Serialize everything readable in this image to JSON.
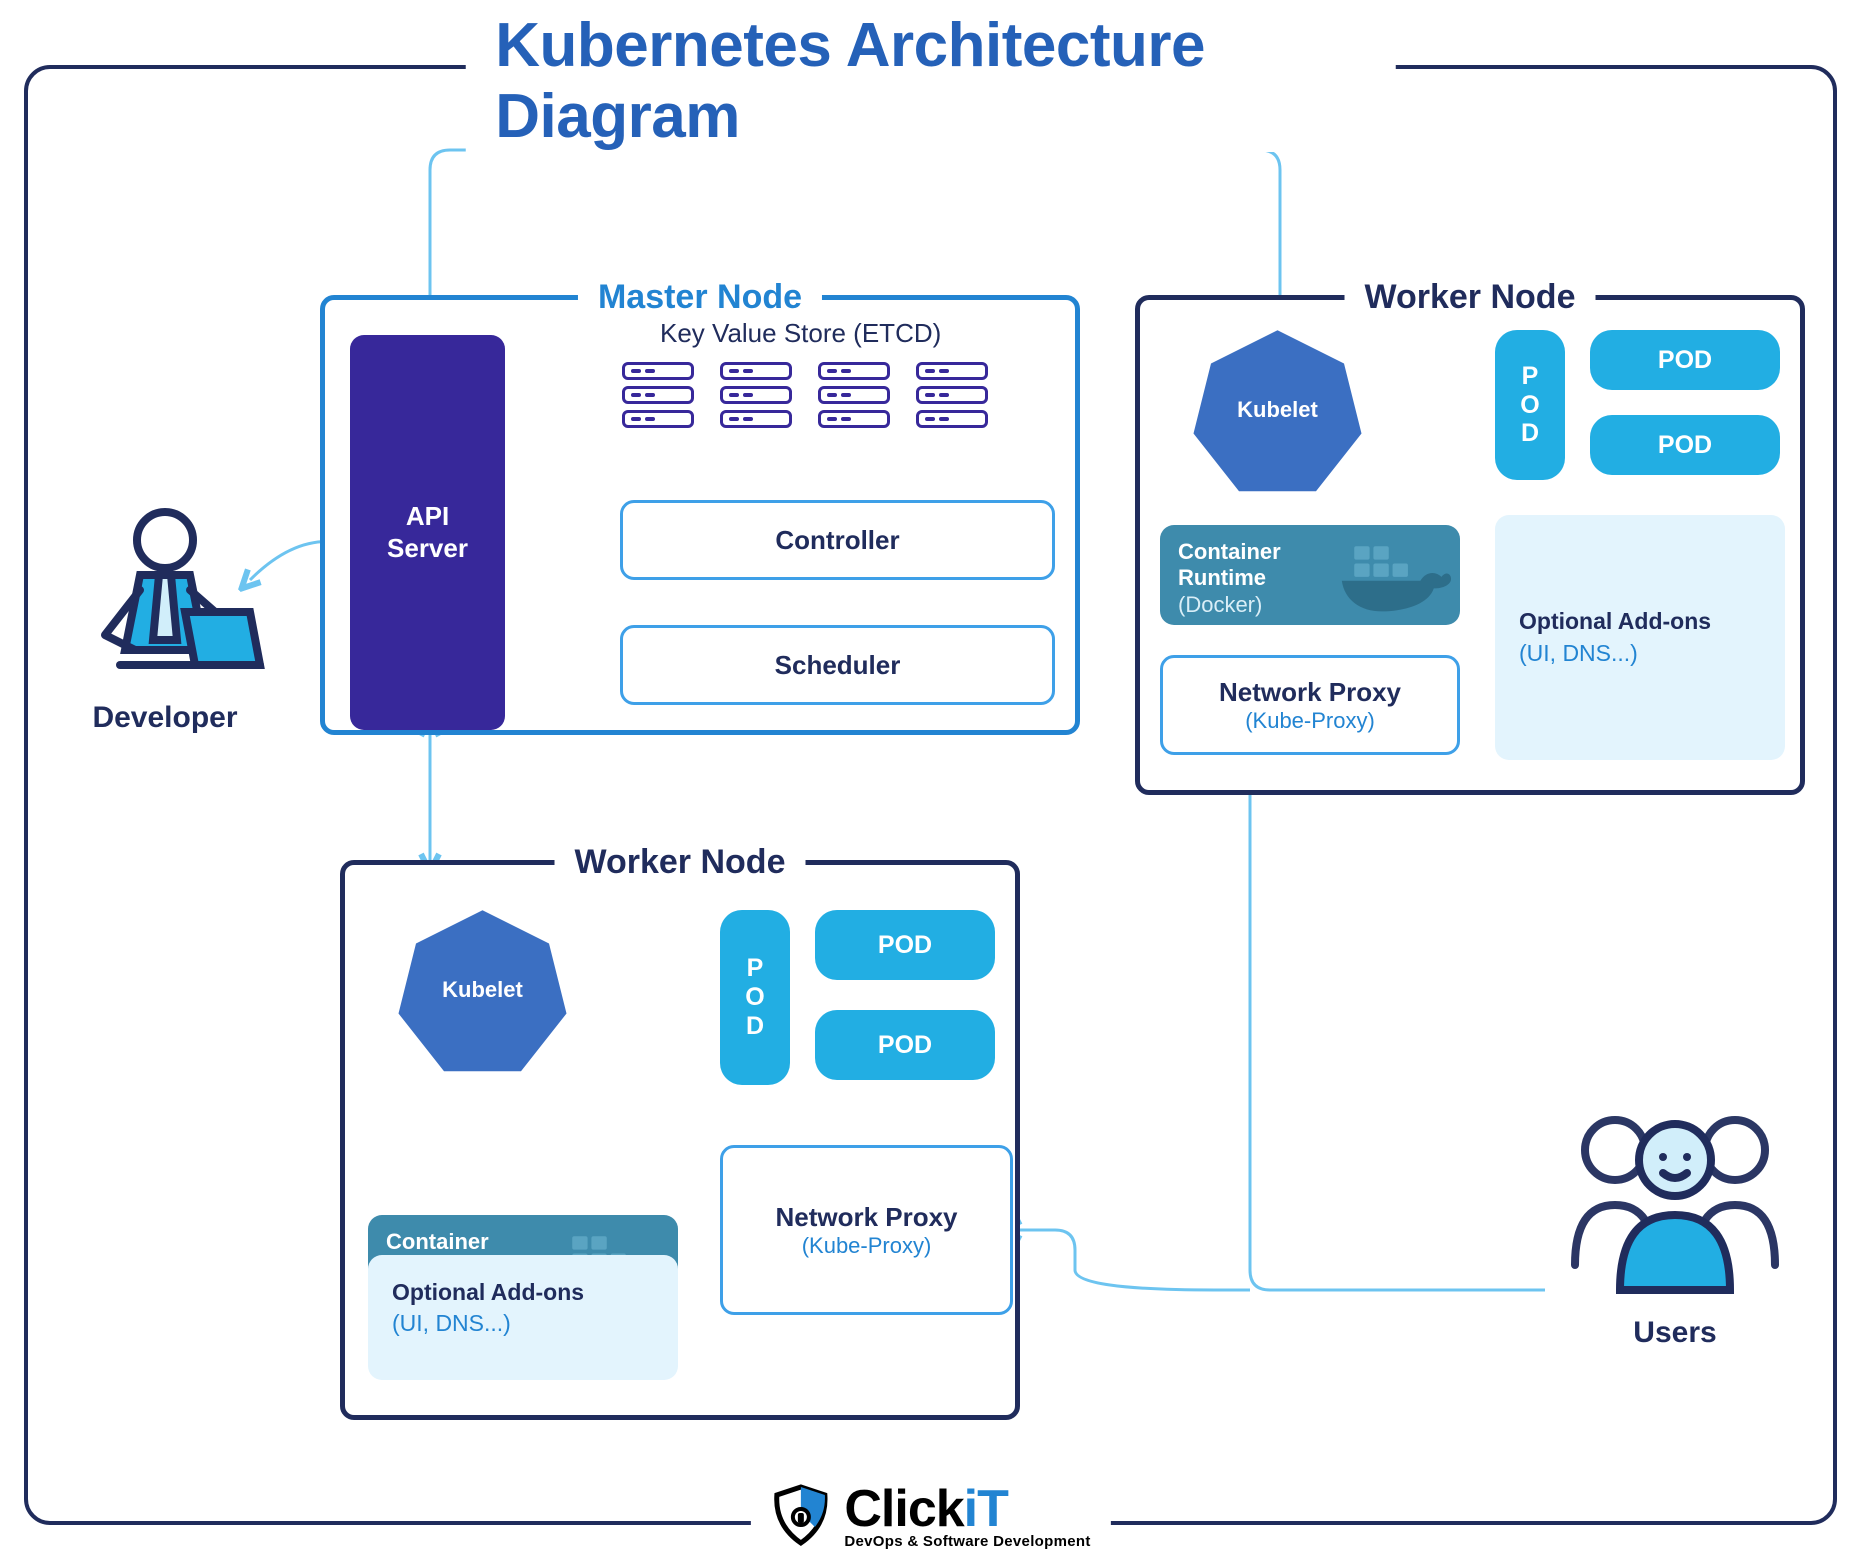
{
  "title": "Kubernetes Architecture Diagram",
  "developer": "Developer",
  "users": "Users",
  "master": {
    "title": "Master Node",
    "api": "API\nServer",
    "etcd": "Key Value Store (ETCD)",
    "controller": "Controller",
    "scheduler": "Scheduler"
  },
  "worker": {
    "title": "Worker Node",
    "kubelet": "Kubelet",
    "runtime_l1": "Container\nRuntime",
    "runtime_l2": "(Docker)",
    "netproxy_l1": "Network Proxy",
    "netproxy_l2": "(Kube-Proxy)",
    "pod_v": "P\nO\nD",
    "pod_h": "POD",
    "addons_l1": "Optional Add-ons",
    "addons_l2": "(UI, DNS...)"
  },
  "logo": {
    "name_a": "Click",
    "name_b": "iT",
    "tagline": "DevOps & Software Development"
  },
  "colors": {
    "navy": "#202c5c",
    "indigo": "#37289a",
    "blue": "#2284d2",
    "cyan": "#22aee3",
    "teal": "#3e8bac"
  }
}
